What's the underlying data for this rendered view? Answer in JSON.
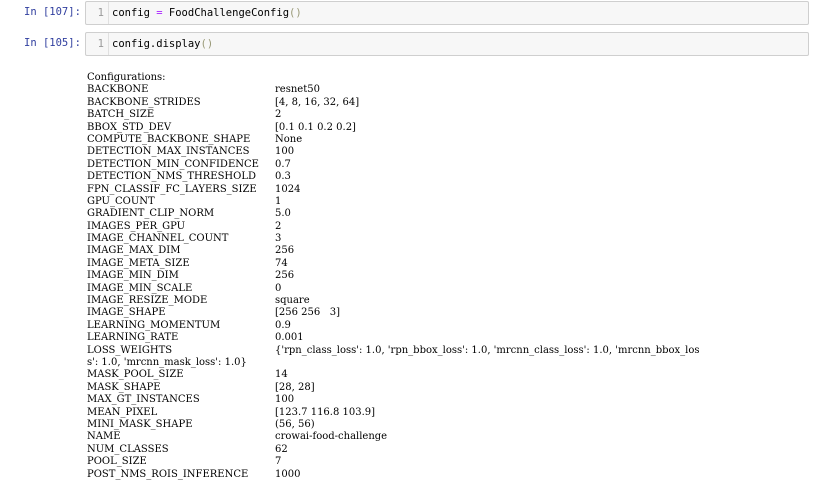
{
  "cells": [
    {
      "prompt": "In [107]:",
      "line_number": "1",
      "code": {
        "lhs": "config ",
        "op": "=",
        "rhs": " FoodChallengeConfig",
        "paren": "()"
      }
    },
    {
      "prompt": "In [105]:",
      "line_number": "1",
      "code": {
        "text": "config.display",
        "paren": "()"
      }
    }
  ],
  "output": {
    "header": "Configurations:",
    "rows": [
      {
        "key": "BACKBONE",
        "value": "resnet50"
      },
      {
        "key": "BACKBONE_STRIDES",
        "value": "[4, 8, 16, 32, 64]"
      },
      {
        "key": "BATCH_SIZE",
        "value": "2"
      },
      {
        "key": "BBOX_STD_DEV",
        "value": "[0.1 0.1 0.2 0.2]"
      },
      {
        "key": "COMPUTE_BACKBONE_SHAPE",
        "value": "None"
      },
      {
        "key": "DETECTION_MAX_INSTANCES",
        "value": "100"
      },
      {
        "key": "DETECTION_MIN_CONFIDENCE",
        "value": "0.7"
      },
      {
        "key": "DETECTION_NMS_THRESHOLD",
        "value": "0.3"
      },
      {
        "key": "FPN_CLASSIF_FC_LAYERS_SIZE",
        "value": "1024"
      },
      {
        "key": "GPU_COUNT",
        "value": "1"
      },
      {
        "key": "GRADIENT_CLIP_NORM",
        "value": "5.0"
      },
      {
        "key": "IMAGES_PER_GPU",
        "value": "2"
      },
      {
        "key": "IMAGE_CHANNEL_COUNT",
        "value": "3"
      },
      {
        "key": "IMAGE_MAX_DIM",
        "value": "256"
      },
      {
        "key": "IMAGE_META_SIZE",
        "value": "74"
      },
      {
        "key": "IMAGE_MIN_DIM",
        "value": "256"
      },
      {
        "key": "IMAGE_MIN_SCALE",
        "value": "0"
      },
      {
        "key": "IMAGE_RESIZE_MODE",
        "value": "square"
      },
      {
        "key": "IMAGE_SHAPE",
        "value": "[256 256   3]"
      },
      {
        "key": "LEARNING_MOMENTUM",
        "value": "0.9"
      },
      {
        "key": "LEARNING_RATE",
        "value": "0.001"
      },
      {
        "key": "LOSS_WEIGHTS",
        "value": "{'rpn_class_loss': 1.0, 'rpn_bbox_loss': 1.0, 'mrcnn_class_loss': 1.0, 'mrcnn_bbox_los"
      }
    ],
    "loss_weights_continuation": "s': 1.0, 'mrcnn_mask_loss': 1.0}",
    "rows_after": [
      {
        "key": "MASK_POOL_SIZE",
        "value": "14"
      },
      {
        "key": "MASK_SHAPE",
        "value": "[28, 28]"
      },
      {
        "key": "MAX_GT_INSTANCES",
        "value": "100"
      },
      {
        "key": "MEAN_PIXEL",
        "value": "[123.7 116.8 103.9]"
      },
      {
        "key": "MINI_MASK_SHAPE",
        "value": "(56, 56)"
      },
      {
        "key": "NAME",
        "value": "crowai-food-challenge"
      },
      {
        "key": "NUM_CLASSES",
        "value": "62"
      },
      {
        "key": "POOL_SIZE",
        "value": "7"
      },
      {
        "key": "POST_NMS_ROIS_INFERENCE",
        "value": "1000"
      }
    ]
  }
}
